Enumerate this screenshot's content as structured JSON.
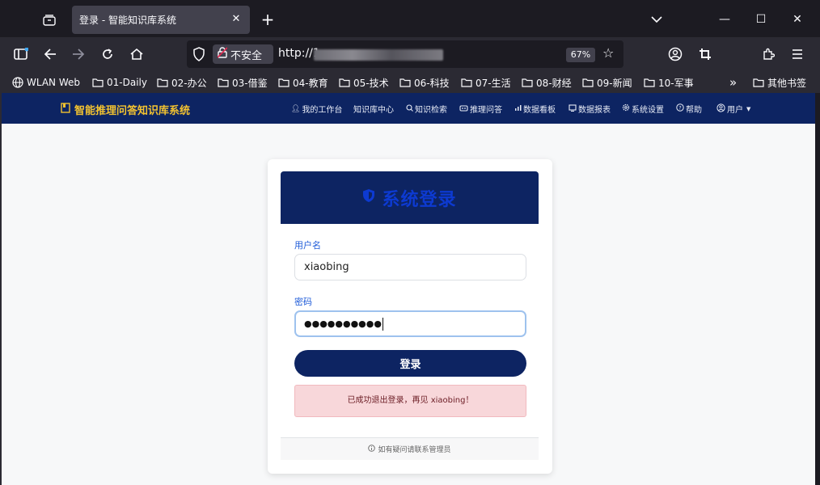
{
  "browser": {
    "tab_title": "登录 - 智能知识库系统",
    "tab_close": "✕",
    "new_tab": "+",
    "window_controls": {
      "minimize": "—",
      "maximize": "☐",
      "close": "✕"
    },
    "insecure_label": "不安全",
    "url_prefix": "http://1",
    "zoom": "67%",
    "icons": [
      "tab-overview-icon",
      "back-icon",
      "forward-icon",
      "reload-icon",
      "home-icon",
      "shield-icon",
      "lock-warning-icon",
      "star-icon",
      "account-icon",
      "crop-icon",
      "extensions-icon",
      "menu-icon"
    ]
  },
  "bookmarks": [
    {
      "label": "WLAN Web",
      "icon": "globe-icon"
    },
    {
      "label": "01-Daily",
      "icon": "folder-icon"
    },
    {
      "label": "02-办公",
      "icon": "folder-icon"
    },
    {
      "label": "03-借鉴",
      "icon": "folder-icon"
    },
    {
      "label": "04-教育",
      "icon": "folder-icon"
    },
    {
      "label": "05-技术",
      "icon": "folder-icon"
    },
    {
      "label": "06-科技",
      "icon": "folder-icon"
    },
    {
      "label": "07-生活",
      "icon": "folder-icon"
    },
    {
      "label": "08-财经",
      "icon": "folder-icon"
    },
    {
      "label": "09-新闻",
      "icon": "folder-icon"
    },
    {
      "label": "10-军事",
      "icon": "folder-icon"
    },
    {
      "label": "»",
      "icon": "overflow-icon"
    },
    {
      "label": "其他书签",
      "icon": "folder-icon"
    }
  ],
  "site": {
    "brand": "智能推理问答知识库系统",
    "menu": [
      {
        "label": "我的工作台",
        "icon": "user-icon"
      },
      {
        "label": "知识库中心",
        "icon": ""
      },
      {
        "label": "知识检索",
        "icon": "search-icon"
      },
      {
        "label": "推理问答",
        "icon": "robot-icon"
      },
      {
        "label": "数据看板",
        "icon": "bar-chart-icon"
      },
      {
        "label": "数据报表",
        "icon": "report-icon"
      },
      {
        "label": "系统设置",
        "icon": "gear-icon"
      },
      {
        "label": "帮助",
        "icon": "help-icon"
      },
      {
        "label": "用户",
        "icon": "user-circle-icon"
      }
    ],
    "colors": {
      "nav_bg": "#0d2462",
      "brand": "#f2c230",
      "title": "#0d3ad1",
      "alert_bg": "#f8d7da"
    }
  },
  "login": {
    "title": "系统登录",
    "username_label": "用户名",
    "username_value": "xiaobing",
    "password_label": "密码",
    "password_masked": "●●●●●●●●●●",
    "submit": "登录",
    "alert": "已成功退出登录，再见 xiaobing！",
    "footer": "如有疑问请联系管理员"
  }
}
